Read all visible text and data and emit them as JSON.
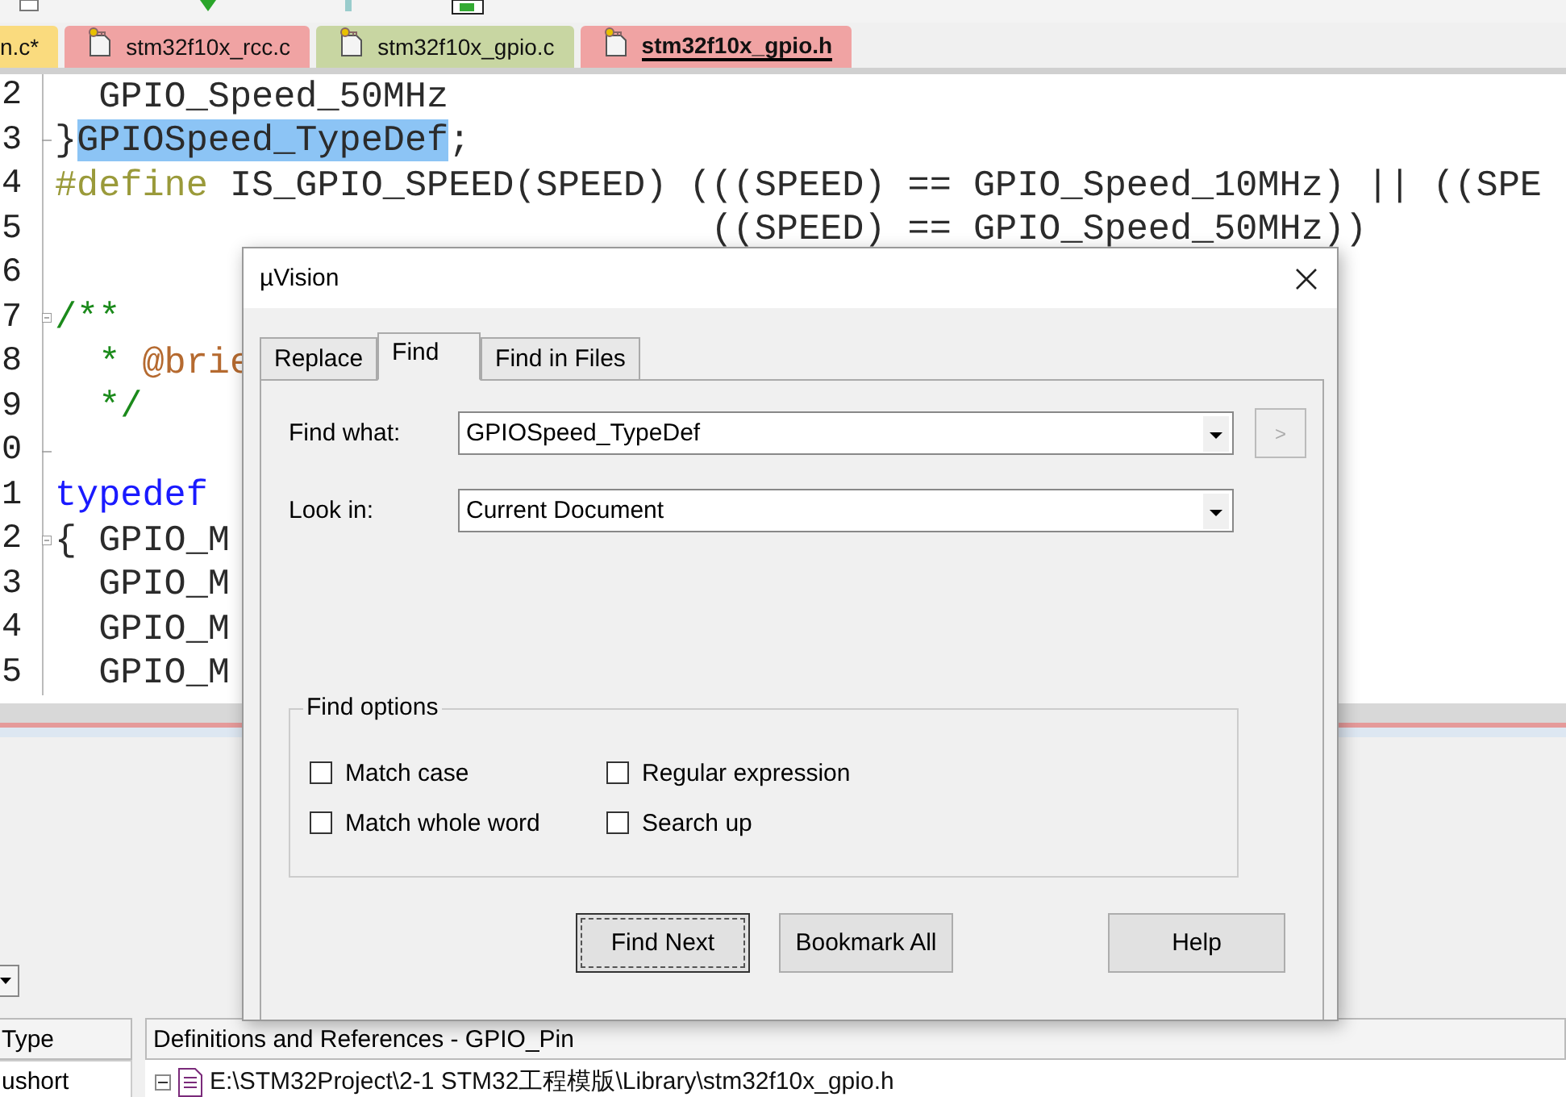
{
  "file_tabs": [
    {
      "label": "n.c*",
      "color": "#fadb7e",
      "selected": false
    },
    {
      "label": "stm32f10x_rcc.c",
      "color": "#f0a3a3",
      "selected": false
    },
    {
      "label": "stm32f10x_gpio.c",
      "color": "#c8d6a2",
      "selected": false
    },
    {
      "label": "stm32f10x_gpio.h",
      "color": "#f0a3a3",
      "selected": true
    }
  ],
  "editor": {
    "lines": [
      {
        "number": "2",
        "kind": "plain",
        "segments": [
          {
            "kind": "plain",
            "text": "  GPIO_Speed_50MHz"
          }
        ]
      },
      {
        "number": "3",
        "kind": "fold-end",
        "segments": [
          {
            "kind": "plain",
            "text": "}"
          },
          {
            "kind": "selected",
            "text": "GPIOSpeed_TypeDef"
          },
          {
            "kind": "plain",
            "text": ";"
          }
        ]
      },
      {
        "number": "4",
        "kind": "plain",
        "segments": [
          {
            "kind": "preprocessor",
            "text": "#define"
          },
          {
            "kind": "plain",
            "text": " IS_GPIO_SPEED(SPEED) (((SPEED) == GPIO_Speed_10MHz) || ((SPE"
          }
        ]
      },
      {
        "number": "5",
        "kind": "plain",
        "segments": [
          {
            "kind": "plain",
            "text": "                              ((SPEED) == GPIO_Speed_50MHz))"
          }
        ]
      },
      {
        "number": "6",
        "kind": "plain"
      },
      {
        "number": "7",
        "kind": "fold-start",
        "segments": [
          {
            "kind": "comment",
            "text": "/**"
          }
        ]
      },
      {
        "number": "8",
        "kind": "plain",
        "segments": [
          {
            "kind": "comment",
            "text": "  * "
          },
          {
            "kind": "doctag",
            "text": "@brie"
          }
        ]
      },
      {
        "number": "9",
        "kind": "plain",
        "segments": [
          {
            "kind": "comment",
            "text": "  */"
          }
        ]
      },
      {
        "number": "0",
        "kind": "fold-end"
      },
      {
        "number": "1",
        "kind": "plain",
        "segments": [
          {
            "kind": "keyword",
            "text": "typedef"
          }
        ]
      },
      {
        "number": "2",
        "kind": "fold-start",
        "segments": [
          {
            "kind": "plain",
            "text": "{ GPIO_M"
          }
        ]
      },
      {
        "number": "3",
        "kind": "plain",
        "segments": [
          {
            "kind": "plain",
            "text": "  GPIO_M"
          }
        ]
      },
      {
        "number": "4",
        "kind": "plain",
        "segments": [
          {
            "kind": "plain",
            "text": "  GPIO_M"
          }
        ]
      },
      {
        "number": "5",
        "kind": "plain",
        "segments": [
          {
            "kind": "plain",
            "text": "  GPIO_M"
          }
        ]
      }
    ]
  },
  "bottom_panel": {
    "columns": [
      {
        "label": "Type"
      },
      {
        "label": "Definitions and References - GPIO_Pin"
      }
    ],
    "rows": [
      {
        "type": "ushort",
        "expanded": true,
        "path": "E:\\STM32Project\\2-1 STM32工程模版\\Library\\stm32f10x_gpio.h"
      }
    ]
  },
  "dialog": {
    "title": "µVision",
    "tabs": [
      {
        "label": "Replace",
        "selected": false
      },
      {
        "label": "Find",
        "selected": true
      },
      {
        "label": "Find in Files",
        "selected": false
      }
    ],
    "fields": [
      {
        "label": "Find what:",
        "value": "GPIOSpeed_TypeDef"
      },
      {
        "label": "Look in:",
        "value": "Current Document"
      }
    ],
    "history_button": {
      "label": ">",
      "disabled": true
    },
    "options_title": "Find options",
    "options": [
      {
        "label": "Match case",
        "checked": false
      },
      {
        "label": "Regular expression",
        "checked": false
      },
      {
        "label": "Match whole word",
        "checked": false
      },
      {
        "label": "Search up",
        "checked": false
      }
    ],
    "buttons": [
      {
        "label": "Find Next",
        "focused": true
      },
      {
        "label": "Bookmark All",
        "focused": false
      },
      {
        "label": "Help",
        "focused": false
      }
    ]
  }
}
